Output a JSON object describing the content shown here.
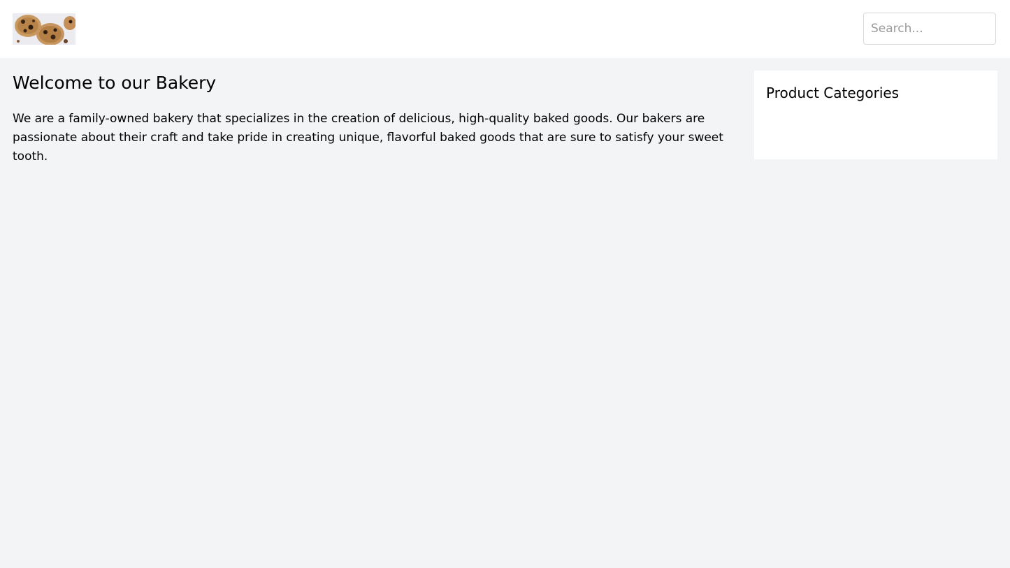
{
  "header": {
    "logo_icon": "cookies-logo-image",
    "search": {
      "placeholder": "Search...",
      "value": ""
    }
  },
  "main": {
    "title": "Welcome to our Bakery",
    "intro": "We are a family-owned bakery that specializes in the creation of delicious, high-quality baked goods. Our bakers are passionate about their craft and take pride in creating unique, flavorful baked goods that are sure to satisfy your sweet tooth."
  },
  "sidebar": {
    "title": "Product Categories",
    "categories": []
  },
  "colors": {
    "page_background": "#f3f4f6",
    "panel_background": "#ffffff",
    "input_border": "#d9d9d9",
    "placeholder": "#9a9a9a"
  }
}
